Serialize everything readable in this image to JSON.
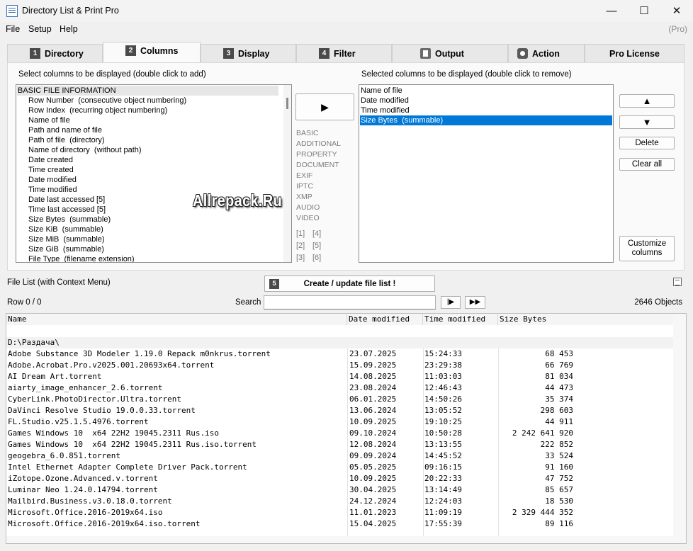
{
  "window": {
    "title": "Directory List & Print Pro",
    "minimize": "—",
    "maximize": "☐",
    "close": "✕"
  },
  "menu": {
    "file": "File",
    "setup": "Setup",
    "help": "Help",
    "pro": "(Pro)"
  },
  "tabs": [
    {
      "num": "1",
      "label": "Directory"
    },
    {
      "num": "2",
      "label": "Columns"
    },
    {
      "num": "3",
      "label": "Display"
    },
    {
      "num": "4",
      "label": "Filter"
    },
    {
      "label": "Output",
      "icon": "document-icon"
    },
    {
      "label": "Action",
      "icon": "gear-icon"
    },
    {
      "label": "Pro License"
    }
  ],
  "columns": {
    "available_caption": "Select columns to be displayed (double click to add)",
    "selected_caption": "Selected columns to be displayed (double click to remove)",
    "available_header": "BASIC FILE INFORMATION",
    "available": [
      "Row Number  (consecutive object numbering)",
      "Row Index  (recurring object numbering)",
      "Name of file",
      "Path and name of file",
      "Path of file  (directory)",
      "Name of directory  (without path)",
      "Date created",
      "Time created",
      "Date modified",
      "Time modified",
      "Date last accessed [5]",
      "Time last accessed [5]",
      "Size Bytes  (summable)",
      "Size KiB  (summable)",
      "Size MiB  (summable)",
      "Size GiB  (summable)",
      "File Type  (filename extension)"
    ],
    "selected": [
      "Name of file",
      "Date modified",
      "Time modified",
      "Size Bytes  (summable)"
    ],
    "add_button": "▶",
    "categories": [
      "BASIC",
      "ADDITIONAL",
      "PROPERTY",
      "DOCUMENT",
      "EXIF",
      "IPTC",
      "XMP",
      "AUDIO",
      "VIDEO"
    ],
    "index_links": [
      "[1]",
      "[4]",
      "[2]",
      "[5]",
      "[3]",
      "[6]"
    ],
    "up_button": "▲",
    "down_button": "▼",
    "delete_button": "Delete",
    "clear_button": "Clear all",
    "customize_button_line1": "Customize",
    "customize_button_line2": "columns"
  },
  "watermark": "Allrepack.Ru",
  "filelist": {
    "label": "File List (with Context Menu)",
    "create_num": "5",
    "create_label": "Create / update file list !",
    "row_status": "Row 0 / 0",
    "search_label": "Search",
    "search_value": "",
    "play_label": "|▶",
    "fast_label": "▶▶",
    "objects": "2646 Objects",
    "headers": [
      "Name",
      "Date modified",
      "Time modified",
      "Size Bytes"
    ],
    "folder": "D:\\Раздача\\",
    "rows": [
      [
        "Adobe Substance 3D Modeler 1.19.0 Repack m0nkrus.torrent",
        "23.07.2025",
        "15:24:33",
        "68 453"
      ],
      [
        "Adobe.Acrobat.Pro.v2025.001.20693x64.torrent",
        "15.09.2025",
        "23:29:38",
        "66 769"
      ],
      [
        "AI Dream Art.torrent",
        "14.08.2025",
        "11:03:03",
        "81 034"
      ],
      [
        "aiarty_image_enhancer_2.6.torrent",
        "23.08.2024",
        "12:46:43",
        "44 473"
      ],
      [
        "CyberLink.PhotoDirector.Ultra.torrent",
        "06.01.2025",
        "14:50:26",
        "35 374"
      ],
      [
        "DaVinci Resolve Studio 19.0.0.33.torrent",
        "13.06.2024",
        "13:05:52",
        "298 603"
      ],
      [
        "FL.Studio.v25.1.5.4976.torrent",
        "10.09.2025",
        "19:10:25",
        "44 911"
      ],
      [
        "Games Windows 10  x64 22H2 19045.2311 Rus.iso",
        "09.10.2024",
        "10:50:28",
        "2 242 641 920"
      ],
      [
        "Games Windows 10  x64 22H2 19045.2311 Rus.iso.torrent",
        "12.08.2024",
        "13:13:55",
        "222 852"
      ],
      [
        "geogebra_6.0.851.torrent",
        "09.09.2024",
        "14:45:52",
        "33 524"
      ],
      [
        "Intel Ethernet Adapter Complete Driver Pack.torrent",
        "05.05.2025",
        "09:16:15",
        "91 160"
      ],
      [
        "iZotope.Ozone.Advanced.v.torrent",
        "10.09.2025",
        "20:22:33",
        "47 752"
      ],
      [
        "Luminar Neo 1.24.0.14794.torrent",
        "30.04.2025",
        "13:14:49",
        "85 657"
      ],
      [
        "Mailbird.Business.v3.0.18.0.torrent",
        "24.12.2024",
        "12:24:03",
        "18 530"
      ],
      [
        "Microsoft.Office.2016-2019x64.iso",
        "11.01.2023",
        "11:09:19",
        "2 329 444 352"
      ],
      [
        "Microsoft.Office.2016-2019x64.iso.torrent",
        "15.04.2025",
        "17:55:39",
        "89 116"
      ]
    ]
  }
}
